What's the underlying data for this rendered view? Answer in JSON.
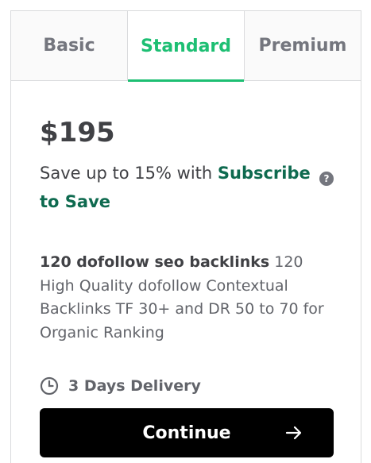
{
  "tabs": [
    {
      "label": "Basic",
      "active": false
    },
    {
      "label": "Standard",
      "active": true
    },
    {
      "label": "Premium",
      "active": false
    }
  ],
  "price": "$195",
  "save": {
    "text": "Save up to 15% with ",
    "link": "Subscribe to Save",
    "help_icon": "?"
  },
  "package": {
    "title": "120 dofollow seo backlinks",
    "description": " 120 High Quality dofollow Contextual Backlinks TF 30+ and DR 50 to 70 for Organic Ranking"
  },
  "delivery": {
    "icon": "clock-icon",
    "label": "3 Days Delivery"
  },
  "continue": {
    "label": "Continue",
    "icon": "arrow-right-icon"
  },
  "colors": {
    "accent": "#1dbf73",
    "link": "#0e6a4f",
    "button": "#000000"
  }
}
